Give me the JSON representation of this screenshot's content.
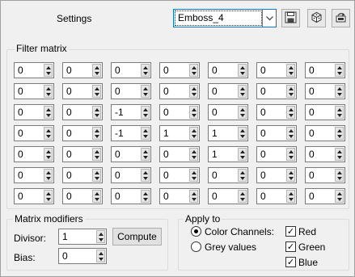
{
  "header": {
    "settings_label": "Settings",
    "preset_value": "Emboss_4",
    "tools": [
      "save-icon",
      "randomize-icon",
      "reset-icon"
    ]
  },
  "filter_matrix": {
    "title": "Filter matrix",
    "rows": [
      [
        "0",
        "0",
        "0",
        "0",
        "0",
        "0",
        "0"
      ],
      [
        "0",
        "0",
        "0",
        "0",
        "0",
        "0",
        "0"
      ],
      [
        "0",
        "0",
        "-1",
        "0",
        "0",
        "0",
        "0"
      ],
      [
        "0",
        "0",
        "-1",
        "1",
        "1",
        "0",
        "0"
      ],
      [
        "0",
        "0",
        "0",
        "0",
        "1",
        "0",
        "0"
      ],
      [
        "0",
        "0",
        "0",
        "0",
        "0",
        "0",
        "0"
      ],
      [
        "0",
        "0",
        "0",
        "0",
        "0",
        "0",
        "0"
      ]
    ]
  },
  "modifiers": {
    "title": "Matrix modifiers",
    "divisor_label": "Divisor:",
    "divisor_value": "1",
    "bias_label": "Bias:",
    "bias_value": "0",
    "compute_label": "Compute"
  },
  "apply_to": {
    "title": "Apply to",
    "color_channels_label": "Color Channels:",
    "grey_values_label": "Grey values",
    "red_label": "Red",
    "green_label": "Green",
    "blue_label": "Blue",
    "mode_selected": "color_channels",
    "red_checked": true,
    "green_checked": true,
    "blue_checked": true
  }
}
